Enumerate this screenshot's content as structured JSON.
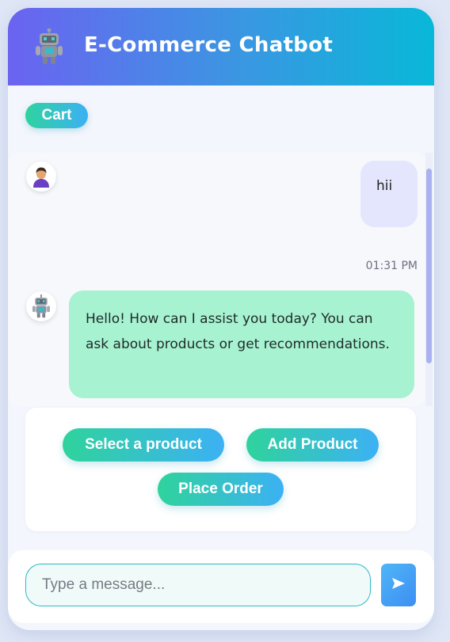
{
  "header": {
    "title": "E-Commerce Chatbot",
    "icon": "robot-icon"
  },
  "toolbar": {
    "cart_label": "Cart"
  },
  "messages": [
    {
      "sender": "user",
      "avatar": "user-avatar-icon",
      "text": "hii",
      "time": "01:31 PM"
    },
    {
      "sender": "bot",
      "avatar": "robot-icon",
      "text": "Hello! How can I assist you today? You can ask about products or get recommendations."
    }
  ],
  "actions": {
    "select_product": "Select a product",
    "add_product": "Add Product",
    "place_order": "Place Order"
  },
  "composer": {
    "placeholder": "Type a message...",
    "send_icon": "send-icon"
  },
  "colors": {
    "header_start": "#6b63f1",
    "header_end": "#08b8d8",
    "user_bubble": "#e3e6fd",
    "bot_bubble": "#a6f2d1",
    "button_start": "#2fd39c",
    "button_end": "#3cb1f4"
  }
}
